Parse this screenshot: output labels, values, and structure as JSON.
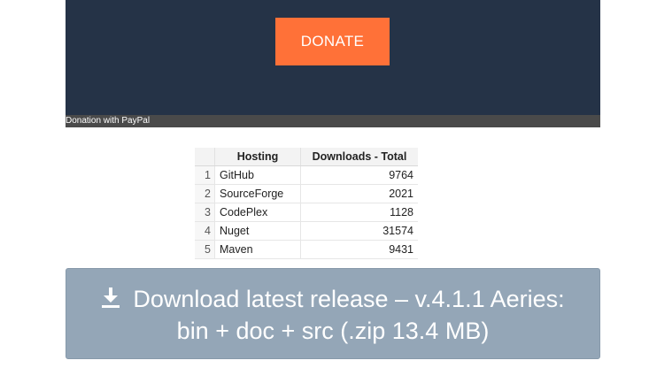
{
  "donation": {
    "button_label": "DONATE",
    "caption": "Donation with PayPal"
  },
  "hosting_table": {
    "headers": [
      "Hosting",
      "Downloads - Total"
    ],
    "rows": [
      {
        "index": "1",
        "hosting": "GitHub",
        "downloads": "9764"
      },
      {
        "index": "2",
        "hosting": "SourceForge",
        "downloads": "2021"
      },
      {
        "index": "3",
        "hosting": "CodePlex",
        "downloads": "1128"
      },
      {
        "index": "4",
        "hosting": "Nuget",
        "downloads": "31574"
      },
      {
        "index": "5",
        "hosting": "Maven",
        "downloads": "9431"
      }
    ]
  },
  "download": {
    "line1": "Download latest release – v.4.1.1 Aeries:",
    "line2": "bin + doc + src (.zip 13.4 MB)",
    "icon": "download-icon"
  },
  "colors": {
    "panel_bg": "#253347",
    "donate_accent": "#ff7138",
    "download_bg": "#94a6b7"
  }
}
